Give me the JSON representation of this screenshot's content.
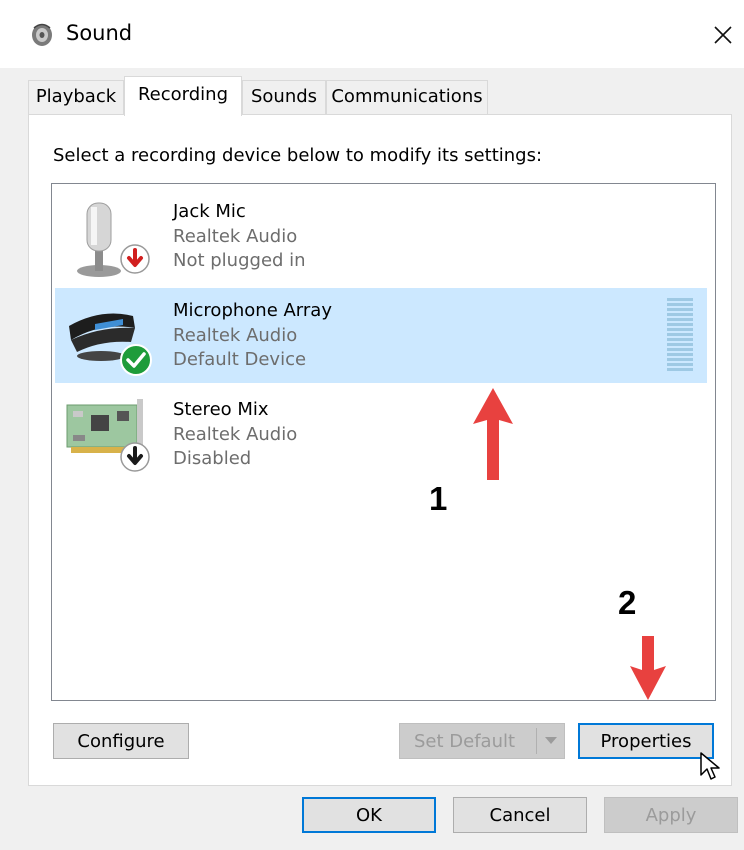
{
  "window": {
    "title": "Sound",
    "close_glyph": "✕"
  },
  "tabs": [
    {
      "label": "Playback",
      "active": false
    },
    {
      "label": "Recording",
      "active": true
    },
    {
      "label": "Sounds",
      "active": false
    },
    {
      "label": "Communications",
      "active": false
    }
  ],
  "instruction": "Select a recording device below to modify its settings:",
  "devices": [
    {
      "name": "Jack Mic",
      "driver": "Realtek Audio",
      "status": "Not plugged in",
      "icon": "microphone-icon",
      "badge": "unplugged-badge-icon",
      "selected": false
    },
    {
      "name": "Microphone Array",
      "driver": "Realtek Audio",
      "status": "Default Device",
      "icon": "microphone-array-icon",
      "badge": "default-check-badge-icon",
      "selected": true
    },
    {
      "name": "Stereo Mix",
      "driver": "Realtek Audio",
      "status": "Disabled",
      "icon": "sound-card-icon",
      "badge": "disabled-badge-icon",
      "selected": false
    }
  ],
  "buttons": {
    "configure": "Configure",
    "set_default": "Set Default",
    "properties": "Properties",
    "ok": "OK",
    "cancel": "Cancel",
    "apply": "Apply"
  },
  "annotations": {
    "step1": "1",
    "step2": "2"
  },
  "colors": {
    "selection": "#cce8ff",
    "focus_border": "#0078d7",
    "arrow": "#e8413f",
    "check_badge": "#1e9c3a"
  }
}
